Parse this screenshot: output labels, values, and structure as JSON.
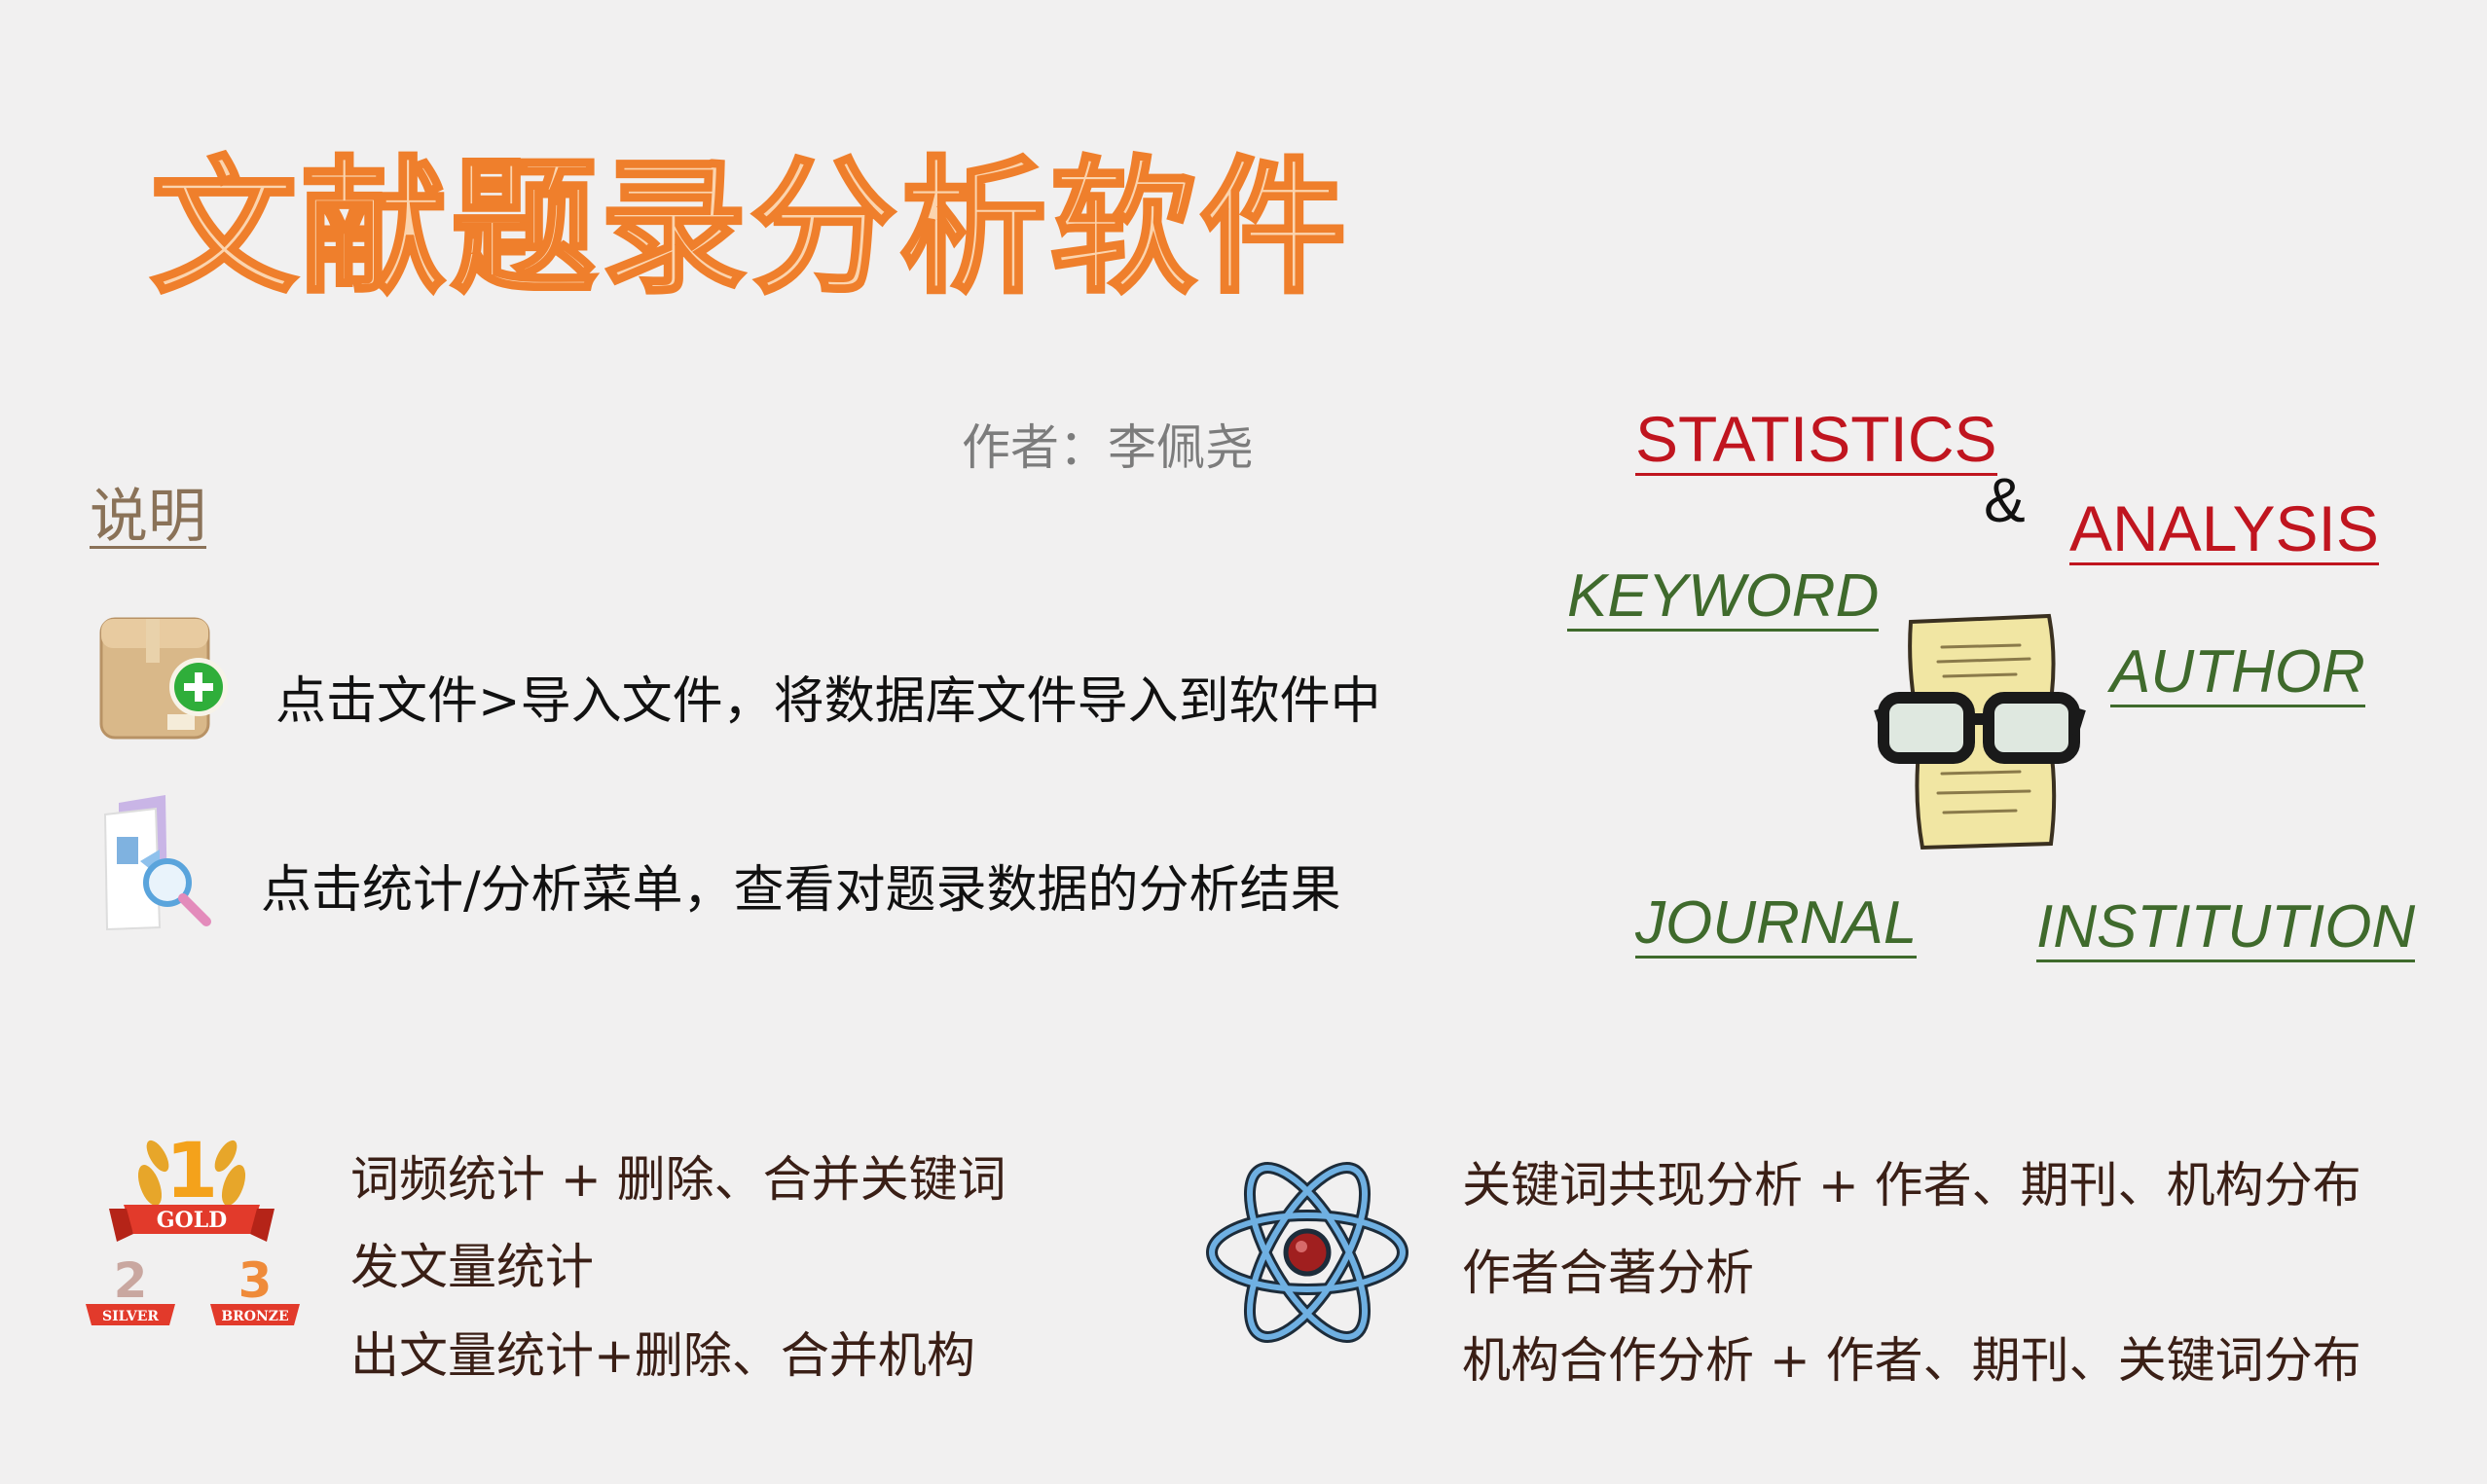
{
  "header": {
    "title": "文献题录分析软件",
    "author": "作者：李佩尧"
  },
  "description": {
    "heading": "说明",
    "steps": [
      {
        "icon": "package-add-icon",
        "text": "点击文件>导入文件，将数据库文件导入到软件中"
      },
      {
        "icon": "document-search-icon",
        "text": "点击统计/分析菜单，查看对题录数据的分析结果"
      }
    ]
  },
  "tags": {
    "statistics": "STATISTICS",
    "ampersand": "&",
    "analysis": "ANALYSIS",
    "keyword": "KEYWORD",
    "author": "AUTHOR",
    "journal": "JOURNAL",
    "institution": "INSTITUTION",
    "mascot_icon": "paper-with-glasses-icon"
  },
  "features": {
    "statistics": {
      "icon": "medal-ranking-icon",
      "medal_labels": [
        "GOLD",
        "SILVER",
        "BRONZE"
      ],
      "medal_numbers": [
        "1",
        "2",
        "3"
      ],
      "lines": [
        "词频统计 + 删除、合并关键词",
        "发文量统计",
        "出文量统计+删除、合并机构"
      ]
    },
    "analysis": {
      "icon": "atom-icon",
      "lines": [
        "关键词共现分析 + 作者、期刊、机构分布",
        "作者合著分析",
        "机构合作分析 + 作者、期刊、关键词分布"
      ]
    }
  },
  "colors": {
    "title_fill": "#fbd4ae",
    "title_stroke": "#ef7f2c",
    "tag_red": "#c0151f",
    "tag_green": "#3f6a2c",
    "feature_text": "#3a1f16"
  }
}
